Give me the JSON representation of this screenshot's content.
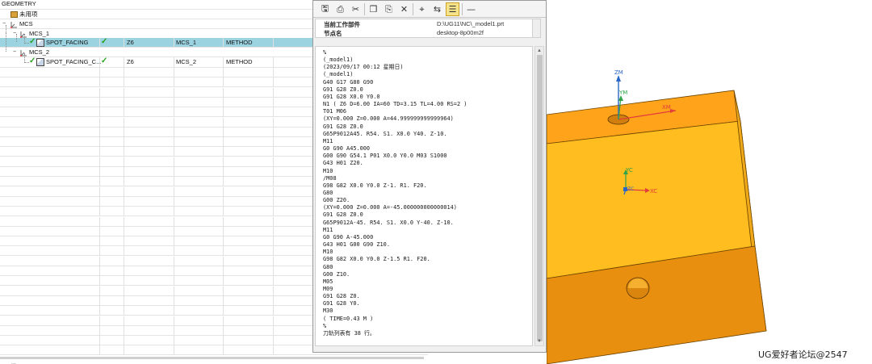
{
  "navigator": {
    "root_label": "GEOMETRY",
    "unused_label": "未用项",
    "rows": [
      {
        "name": "MCS",
        "level": 0
      },
      {
        "name": "MCS_1",
        "level": 1
      },
      {
        "name": "SPOT_FACING",
        "tool": "Z6",
        "geometry": "MCS_1",
        "method": "METHOD",
        "status": "✓",
        "selected": true
      },
      {
        "name": "MCS_2",
        "level": 1
      },
      {
        "name": "SPOT_FACING_C...",
        "tool": "Z6",
        "geometry": "MCS_2",
        "method": "METHOD",
        "status": "✓",
        "selected": false
      }
    ],
    "bottom_text": "..."
  },
  "info_window": {
    "toolbar_icons": [
      "save-icon",
      "print-icon",
      "cut-icon",
      "copy-icon",
      "paste-icon",
      "delete-icon",
      "find-icon",
      "replace-icon",
      "wrap-icon",
      "minimize-icon"
    ],
    "header": [
      {
        "label": "当前工作部件",
        "value": "D:\\UG11\\NC\\_model1.prt"
      },
      {
        "label": "节点名",
        "value": "desktop-8p00m2f"
      }
    ],
    "code": [
      "%",
      "(_model1)",
      "(2023/09/17 00:12 星期日)",
      "(_model1)",
      "G40 G17 G80 G90",
      "G91 G28 Z0.0",
      "G91 G28 X0.0 Y0.0",
      "N1 ( Z6 D=6.00 IA=60 TD=3.15 TL=4.00 RS=2 )",
      "T01 M06",
      "(XY=0.000 Z=0.000 A=44.999999999999964)",
      "G91 G28 Z0.0",
      "G65P9012A45. R54. S1. X0.0 Y40. Z-10.",
      "M11",
      "G0 G90 A45.000",
      "G00 G90 G54.1 P01 X0.0 Y0.0 M03 S1000",
      "G43 H01 Z20.",
      "M10",
      "/M08",
      "G98 G82 X0.0 Y0.0 Z-1. R1. F20.",
      "G80",
      "G00 Z20.",
      "(XY=0.000 Z=0.000 A=-45.000000000000014)",
      "G91 G28 Z0.0",
      "G65P9012A-45. R54. S1. X0.0 Y-40. Z-10.",
      "M11",
      "G0 G90 A-45.000",
      "G43 H01 G00 G90 Z10.",
      "M10",
      "G98 G82 X0.0 Y0.0 Z-1.5 R1. F20.",
      "G80",
      "G00 Z10.",
      "M05",
      "M09",
      "G91 G28 Z0.",
      "G91 G28 Y0.",
      "M30",
      "( TIME=0.43 M )",
      "%",
      "刀轨列表有 38 行。"
    ]
  },
  "viewport": {
    "axis_labels": {
      "zm": "ZM",
      "ym": "YM",
      "xm": "XM",
      "yc": "YC",
      "zc": "ZC",
      "xc": "XC"
    },
    "colors": {
      "top_face": "#ffbd1f",
      "top_band": "#ffa01a",
      "front_face": "#e69010",
      "side_face": "#efa818",
      "edge": "#6a4300",
      "x_axis": "#e33c3c",
      "y_axis": "#2da34a",
      "z_axis": "#2a66c8"
    }
  },
  "watermark": "UG爱好者论坛@2547"
}
